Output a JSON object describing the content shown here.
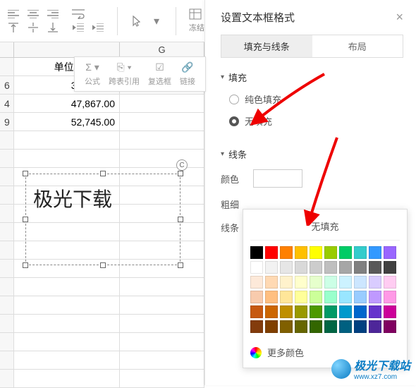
{
  "toolbar2": {
    "formula": "公式",
    "crossref": "跨表引用",
    "checkbox": "复选框",
    "link": "链接"
  },
  "sheet": {
    "column_g": "G",
    "header_row": "单位4",
    "rows": [
      {
        "n": "6",
        "v": "35,727.00"
      },
      {
        "n": "4",
        "v": "47,867.00"
      },
      {
        "n": "9",
        "v": "52,745.00"
      }
    ]
  },
  "textbox": {
    "text": "极光下载",
    "rotate": "C"
  },
  "panel": {
    "title": "设置文本框格式",
    "tab_fill": "填充与线条",
    "tab_layout": "布局",
    "section_fill": "填充",
    "fill_solid": "纯色填充",
    "fill_none": "无填充",
    "section_line": "线条",
    "prop_color": "颜色",
    "prop_weight": "粗细",
    "prop_linetype": "线条"
  },
  "picker": {
    "nofill": "无填充",
    "more": "更多颜色",
    "colors": [
      [
        "#000000",
        "#ff0000",
        "#ff8000",
        "#ffc000",
        "#ffff00",
        "#99cc00",
        "#00cc66",
        "#33cccc",
        "#3399ff",
        "#9966ff"
      ],
      [
        "#ffffff",
        "#f2f2f2",
        "#e6e6e6",
        "#d9d9d9",
        "#cccccc",
        "#bfbfbf",
        "#a6a6a6",
        "#808080",
        "#595959",
        "#404040"
      ],
      [
        "#fde9d9",
        "#ffd9b3",
        "#fff2cc",
        "#ffffcc",
        "#e6ffcc",
        "#ccffe6",
        "#ccf2ff",
        "#cce6ff",
        "#d9ccff",
        "#ffccf2"
      ],
      [
        "#f8cbad",
        "#ffbf80",
        "#ffe699",
        "#ffff99",
        "#ccff99",
        "#99ffcc",
        "#99e6ff",
        "#99ccff",
        "#bf99ff",
        "#ff99e6"
      ],
      [
        "#c65911",
        "#cc6600",
        "#bf8f00",
        "#999900",
        "#4d9900",
        "#009966",
        "#0099cc",
        "#0066cc",
        "#6633cc",
        "#cc0099"
      ],
      [
        "#833c0c",
        "#804000",
        "#806000",
        "#666600",
        "#336600",
        "#006644",
        "#006080",
        "#004080",
        "#4d2699",
        "#800060"
      ]
    ]
  },
  "watermark": {
    "name": "极光下载站",
    "url": "www.xz7.com"
  }
}
